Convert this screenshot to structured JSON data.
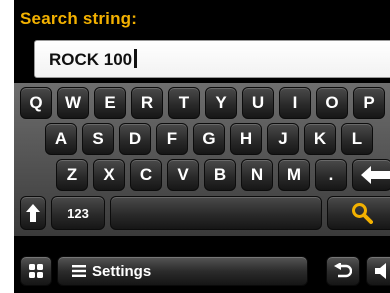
{
  "header": {
    "title": "Search string:"
  },
  "search": {
    "value": "ROCK 100"
  },
  "keyboard": {
    "row1": [
      "Q",
      "W",
      "E",
      "R",
      "T",
      "Y",
      "U",
      "I",
      "O",
      "P"
    ],
    "row2": [
      "A",
      "S",
      "D",
      "F",
      "G",
      "H",
      "J",
      "K",
      "L"
    ],
    "row3": [
      "Z",
      "X",
      "C",
      "V",
      "B",
      "N",
      "M",
      "."
    ],
    "numbers_label": "123",
    "icons": {
      "shift": "up-arrow-icon",
      "backspace": "back-arrow-icon",
      "search": "magnifier-icon"
    }
  },
  "bottom_bar": {
    "settings_label": "Settings",
    "icons": {
      "grid": "grid-icon",
      "menu": "menu-lines-icon",
      "back": "return-icon",
      "volume": "speaker-icon"
    }
  },
  "colors": {
    "title": "#f3b100",
    "search_icon": "#f3b100"
  }
}
